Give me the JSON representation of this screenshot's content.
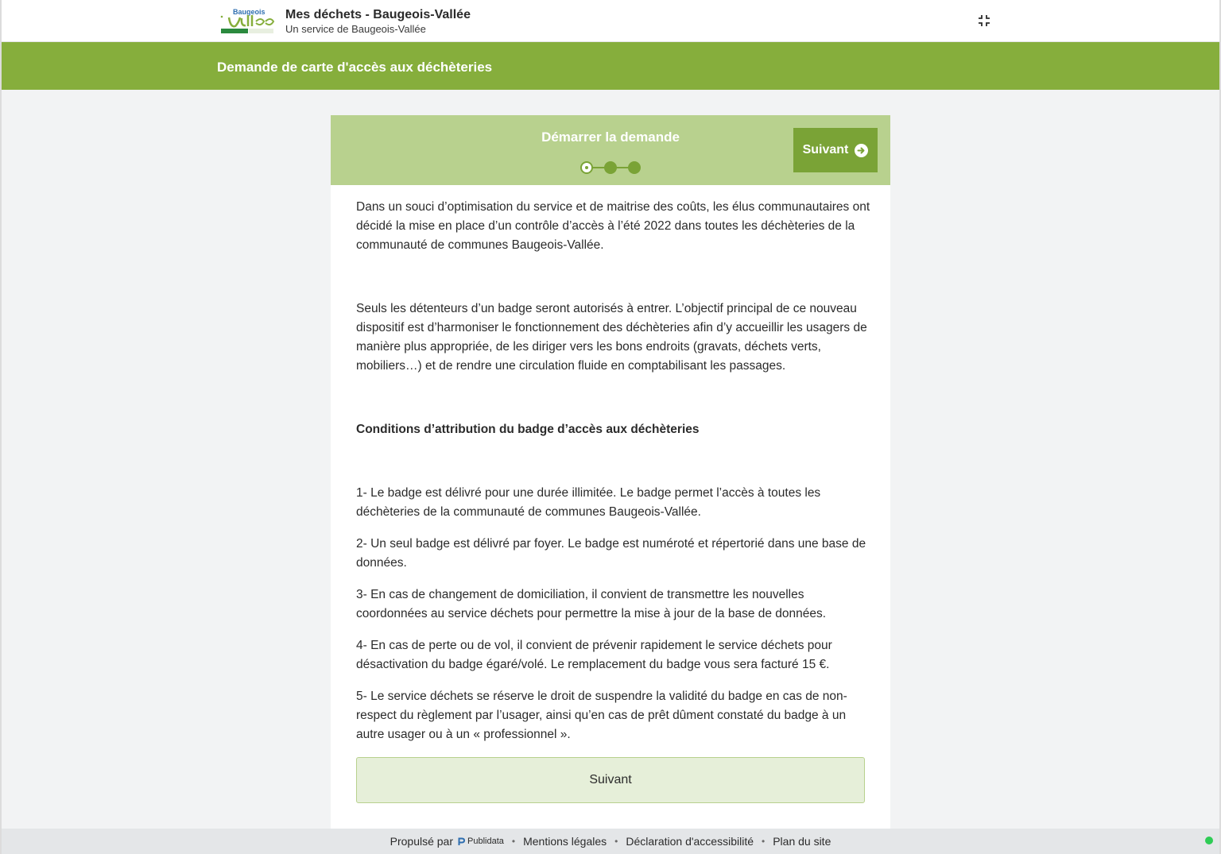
{
  "header": {
    "logo_text": "Baugeois Vallée",
    "title": "Mes déchets - Baugeois-Vallée",
    "subtitle": "Un service de Baugeois-Vallée",
    "collapse_icon": "collapse-icon"
  },
  "banner": {
    "title": "Demande de carte d'accès aux déchèteries"
  },
  "form": {
    "step_title": "Démarrer la demande",
    "steps_total": 3,
    "current_step": 1,
    "next_top_label": "Suivant",
    "intro_1": "Dans un souci d’optimisation du service et de maitrise des coûts, les élus communautaires ont décidé la mise en place d’un contrôle d’accès à l’été 2022 dans toutes les déchèteries de la communauté de communes Baugeois-Vallée.",
    "intro_2": "Seuls les détenteurs d’un badge seront autorisés à entrer. L’objectif principal de ce nouveau dispositif est d’harmoniser le fonctionnement des déchèteries afin d’y accueillir les usagers de manière plus appropriée, de les diriger vers les bons endroits (gravats, déchets verts, mobiliers…) et de rendre une circulation fluide en comptabilisant les passages.",
    "conditions_title": "Conditions d’attribution du badge d’accès aux déchèteries",
    "conditions": [
      "1- Le badge est délivré pour une durée illimitée. Le badge permet l’accès à toutes les déchèteries de la communauté de communes Baugeois-Vallée.",
      "2- Un seul badge est délivré par foyer. Le badge est numéroté et répertorié dans une base de données.",
      "3- En cas de changement de domiciliation, il convient de transmettre les nouvelles coordonnées au service déchets pour permettre la mise à jour de la base de données.",
      "4- En cas de perte ou de vol, il convient de prévenir rapidement le service déchets pour désactivation du badge égaré/volé. Le remplacement du badge vous sera facturé 15 €.",
      "5- Le service déchets se réserve le droit de suspendre la validité du badge en cas de non-respect du règlement par l’usager, ainsi qu’en cas de prêt dûment constaté du badge à un autre usager ou à un « professionnel »."
    ],
    "next_bottom_label": "Suivant"
  },
  "footer": {
    "powered_by": "Propulsé par",
    "brand": "Publidata",
    "links": [
      "Mentions légales",
      "Déclaration d'accessibilité",
      "Plan du site"
    ]
  },
  "colors": {
    "brand_green": "#86ae3c",
    "light_green": "#b8d18e",
    "button_green": "#7aa336",
    "status_online": "#2ecc55"
  }
}
